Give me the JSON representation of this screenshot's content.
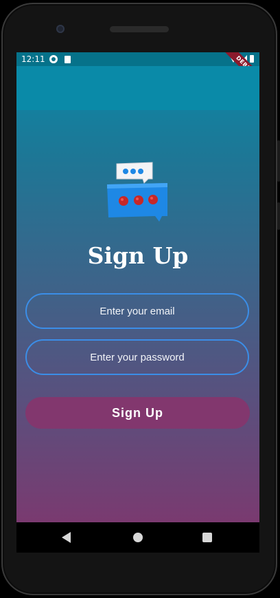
{
  "status_bar": {
    "time": "12:11"
  },
  "debug_banner": {
    "label": "DEBUG"
  },
  "page": {
    "title": "Sign Up"
  },
  "form": {
    "email_placeholder": "Enter your email",
    "email_value": "",
    "password_placeholder": "Enter your password",
    "password_value": "",
    "submit_label": "Sign Up"
  },
  "colors": {
    "gradient_top": "#0a8aa8",
    "gradient_bottom": "#7a3a70",
    "field_border": "#3b8ee8",
    "button_bg": "#82376e",
    "logo_blue": "#1e88e5",
    "logo_red": "#c62828"
  },
  "icons": {
    "logo": "chat-bubbles-icon",
    "nav_back": "back-triangle-icon",
    "nav_home": "home-circle-icon",
    "nav_recent": "recents-square-icon"
  }
}
